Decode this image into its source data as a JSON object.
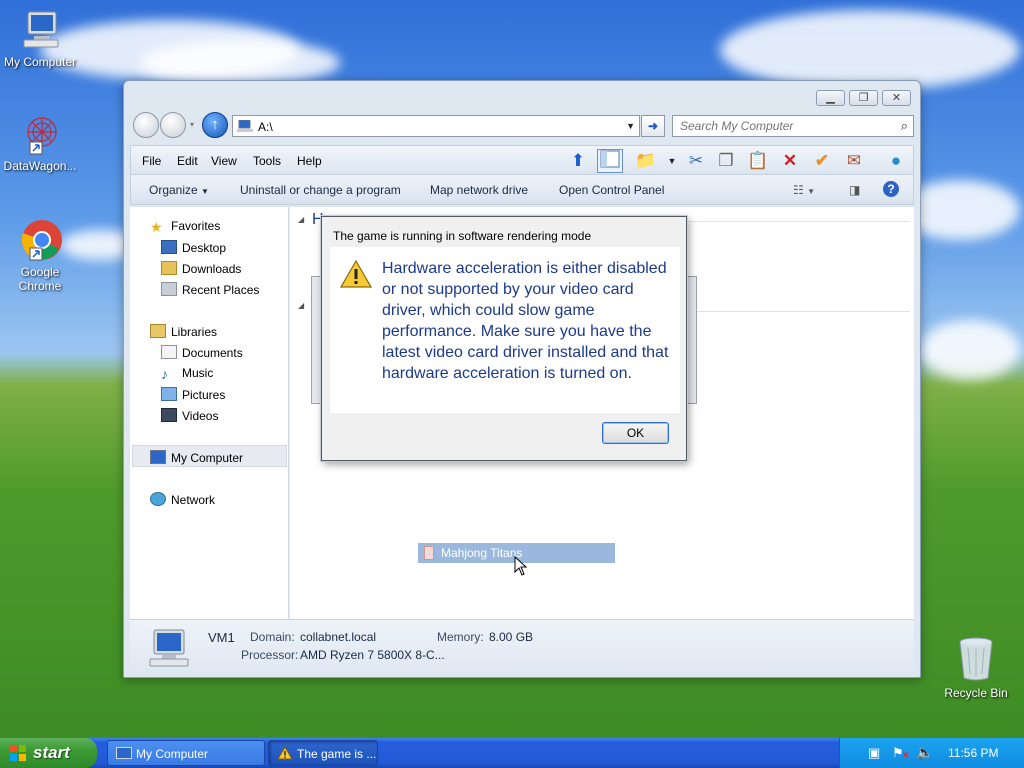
{
  "desktop": {
    "icons": [
      {
        "label": "My Computer"
      },
      {
        "label": "DataWagon..."
      },
      {
        "label": "Google Chrome"
      }
    ],
    "recycle_bin": {
      "label": "Recycle Bin"
    }
  },
  "explorer": {
    "address": "A:\\",
    "search_placeholder": "Search My Computer",
    "menu": [
      "File",
      "Edit",
      "View",
      "Tools",
      "Help"
    ],
    "commands": [
      "Organize",
      "Uninstall or change a program",
      "Map network drive",
      "Open Control Panel"
    ],
    "nav": {
      "favorites": "Favorites",
      "desktop": "Desktop",
      "downloads": "Downloads",
      "recent": "Recent Places",
      "libraries": "Libraries",
      "documents": "Documents",
      "music": "Music",
      "pictures": "Pictures",
      "videos": "Videos",
      "my_computer": "My Computer",
      "network": "Network"
    },
    "content_heading_letter": "H",
    "details": {
      "name": "VM1",
      "domain_label": "Domain:",
      "domain_value": "collabnet.local",
      "memory_label": "Memory:",
      "memory_value": "8.00 GB",
      "processor_label": "Processor:",
      "processor_value": "AMD Ryzen 7 5800X 8-C..."
    }
  },
  "drag_item": "Mahjong Titans",
  "dialog": {
    "title": "The game is running in software rendering mode",
    "message": "Hardware acceleration is either disabled or not supported by your video card driver, which could slow game performance. Make sure you have the latest video card driver installed and that hardware acceleration is turned on.",
    "ok_label": "OK"
  },
  "taskbar": {
    "start_label": "start",
    "tasks": [
      {
        "label": "My Computer"
      },
      {
        "label": "The game is ..."
      }
    ],
    "clock": "11:56 PM"
  },
  "colors": {
    "dialog_text": "#1c3a8c",
    "taskbar": "#245ddb",
    "start": "#3c9a35",
    "tray": "#0f8ce0"
  }
}
